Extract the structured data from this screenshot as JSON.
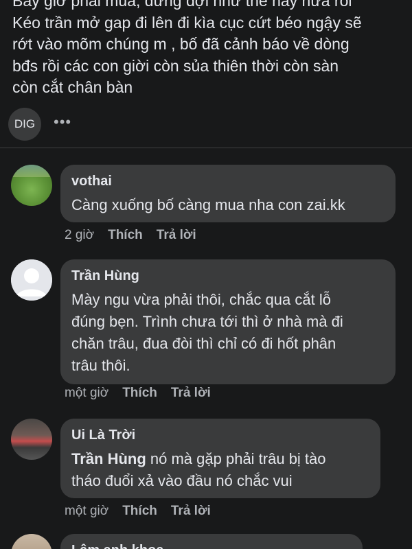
{
  "post": {
    "lines": [
      "Bây giờ phải mua, đừng đợi như thế này nữa rồi",
      "Kéo trần mở gap đi lên đi kìa cục cứt béo ngậy sẽ",
      "rớt vào mõm chúng m , bố đã cảnh báo về dòng",
      "bđs rồi các con giời còn sủa thiên thời còn sàn",
      "còn cắt chân bàn"
    ]
  },
  "reaction_bar": {
    "avatar_text": "DIG",
    "more_label": "•••"
  },
  "comments": [
    {
      "author": "vothai",
      "avatar": "grass-photo",
      "lines": [
        "Càng xuống bố càng mua nha con zai.kk"
      ],
      "time": "2 giờ",
      "like": "Thích",
      "reply": "Trả lời"
    },
    {
      "author": "Trần Hùng",
      "avatar": "default-avatar",
      "lines": [
        "Mày ngu vừa phải thôi, chắc qua cắt lỗ",
        "đúng bẹn. Trình chưa tới thì ở nhà mà đi",
        "chăn trâu, đua đòi thì chỉ có đi hốt phân",
        "trâu thôi."
      ],
      "time": "một giờ",
      "like": "Thích",
      "reply": "Trả lời"
    },
    {
      "author": "Ui Là Trời",
      "avatar": "street-photo",
      "mention": "Trần Hùng",
      "lines": [
        " nó mà gặp phải trâu bị tào",
        "tháo đuổi xả vào đầu nó chắc vui"
      ],
      "time": "một giờ",
      "like": "Thích",
      "reply": "Trả lời"
    },
    {
      "author": "Lâm anh khoa",
      "avatar": "partial-photo"
    }
  ],
  "colors": {
    "background": "#18191a",
    "bubble": "#3a3b3c",
    "text": "#e4e6eb",
    "secondary": "#b0b3b8"
  }
}
